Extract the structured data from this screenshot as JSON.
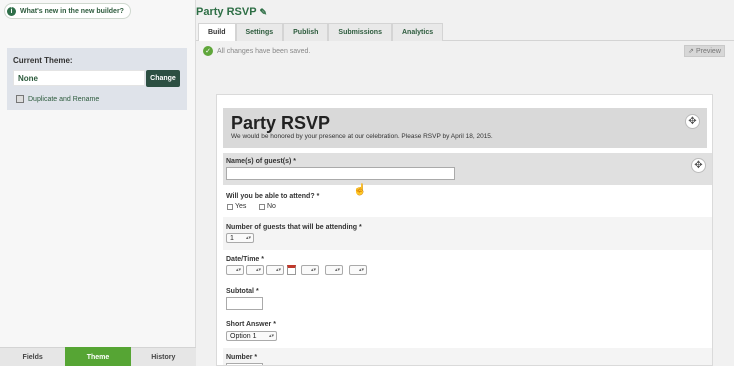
{
  "whats_new": "What's new in the new builder?",
  "theme": {
    "label": "Current Theme:",
    "value": "None",
    "change_label": "Change",
    "duplicate_label": "Duplicate and Rename"
  },
  "left_tabs": [
    "Fields",
    "Theme",
    "History"
  ],
  "form_title": "Party RSVP",
  "tabs": [
    "Build",
    "Settings",
    "Publish",
    "Submissions",
    "Analytics"
  ],
  "saved_text": "All changes have been saved.",
  "preview_label": "Preview",
  "form": {
    "heading": "Party RSVP",
    "description": "We would be honored by your presence at our celebration.  Please RSVP by April 18, 2015.",
    "fields": {
      "names": "Name(s) of guest(s)",
      "attend": "Will you be able to attend?",
      "attend_yes": "Yes",
      "attend_no": "No",
      "num_guests": "Number of guests that will be attending",
      "num_guests_value": "1",
      "datetime": "Date/Time",
      "subtotal": "Subtotal",
      "short_answer": "Short Answer",
      "short_answer_value": "Option 1",
      "number": "Number"
    },
    "required_mark": "*"
  },
  "colors": {
    "accent_green": "#56a534",
    "title_green": "#2d6e45",
    "dark_button": "#2c4f42"
  }
}
